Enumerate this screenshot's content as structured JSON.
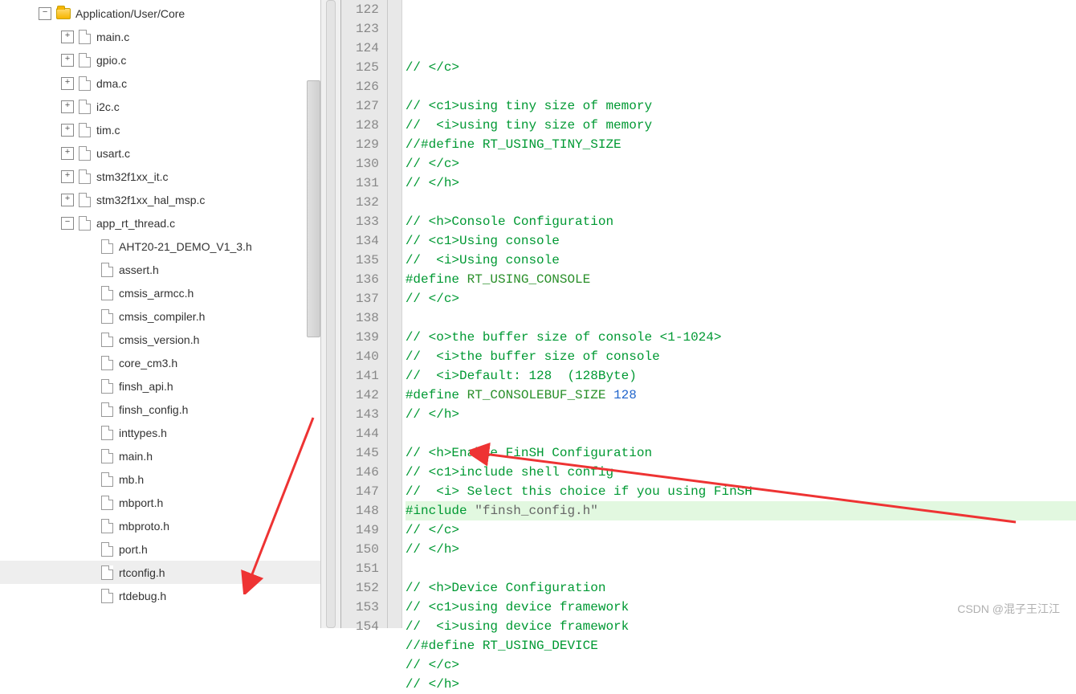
{
  "tree": {
    "root": {
      "label": "Application/User/Core"
    },
    "files": [
      {
        "label": "main.c",
        "exp": true
      },
      {
        "label": "gpio.c",
        "exp": true
      },
      {
        "label": "dma.c",
        "exp": true
      },
      {
        "label": "i2c.c",
        "exp": true
      },
      {
        "label": "tim.c",
        "exp": true
      },
      {
        "label": "usart.c",
        "exp": true
      },
      {
        "label": "stm32f1xx_it.c",
        "exp": true
      },
      {
        "label": "stm32f1xx_hal_msp.c",
        "exp": true
      },
      {
        "label": "app_rt_thread.c",
        "exp": true,
        "open": true
      }
    ],
    "headers": [
      "AHT20-21_DEMO_V1_3.h",
      "assert.h",
      "cmsis_armcc.h",
      "cmsis_compiler.h",
      "cmsis_version.h",
      "core_cm3.h",
      "finsh_api.h",
      "finsh_config.h",
      "inttypes.h",
      "main.h",
      "mb.h",
      "mbport.h",
      "mbproto.h",
      "port.h",
      "rtconfig.h",
      "rtdebug.h"
    ],
    "selected": "rtconfig.h"
  },
  "code": {
    "start": 122,
    "lines": [
      {
        "t": "// </c>",
        "c": "cmt"
      },
      {
        "t": "",
        "c": ""
      },
      {
        "t": "// <c1>using tiny size of memory",
        "c": "cmt"
      },
      {
        "t": "//  <i>using tiny size of memory",
        "c": "cmt"
      },
      {
        "t": "//#define RT_USING_TINY_SIZE",
        "c": "cmt"
      },
      {
        "t": "// </c>",
        "c": "cmt"
      },
      {
        "t": "// </h>",
        "c": "cmt"
      },
      {
        "t": "",
        "c": ""
      },
      {
        "t": "// <h>Console Configuration",
        "c": "cmt"
      },
      {
        "t": "// <c1>Using console",
        "c": "cmt"
      },
      {
        "t": "//  <i>Using console",
        "c": "cmt"
      },
      {
        "seg": [
          [
            "#define ",
            "pp"
          ],
          [
            "RT_USING_CONSOLE",
            "mac"
          ]
        ]
      },
      {
        "t": "// </c>",
        "c": "cmt"
      },
      {
        "t": "",
        "c": ""
      },
      {
        "t": "// <o>the buffer size of console <1-1024>",
        "c": "cmt"
      },
      {
        "t": "//  <i>the buffer size of console",
        "c": "cmt"
      },
      {
        "t": "//  <i>Default: 128  (128Byte)",
        "c": "cmt"
      },
      {
        "seg": [
          [
            "#define ",
            "pp"
          ],
          [
            "RT_CONSOLEBUF_SIZE ",
            "mac"
          ],
          [
            "128",
            "num"
          ]
        ]
      },
      {
        "t": "// </h>",
        "c": "cmt"
      },
      {
        "t": "",
        "c": ""
      },
      {
        "t": "// <h>Enable FinSH Configuration",
        "c": "cmt"
      },
      {
        "t": "// <c1>include shell config",
        "c": "cmt"
      },
      {
        "t": "//  <i> Select this choice if you using FinSH",
        "c": "cmt"
      },
      {
        "hl": true,
        "seg": [
          [
            "#include ",
            "pp"
          ],
          [
            "\"finsh_config.h\"",
            "str"
          ]
        ]
      },
      {
        "t": "// </c>",
        "c": "cmt"
      },
      {
        "t": "// </h>",
        "c": "cmt"
      },
      {
        "t": "",
        "c": ""
      },
      {
        "t": "// <h>Device Configuration",
        "c": "cmt"
      },
      {
        "t": "// <c1>using device framework",
        "c": "cmt"
      },
      {
        "t": "//  <i>using device framework",
        "c": "cmt"
      },
      {
        "t": "//#define RT_USING_DEVICE",
        "c": "cmt"
      },
      {
        "t": "// </c>",
        "c": "cmt"
      },
      {
        "t": "// </h>",
        "c": "cmt"
      }
    ]
  },
  "watermark": "CSDN @混子王江江"
}
